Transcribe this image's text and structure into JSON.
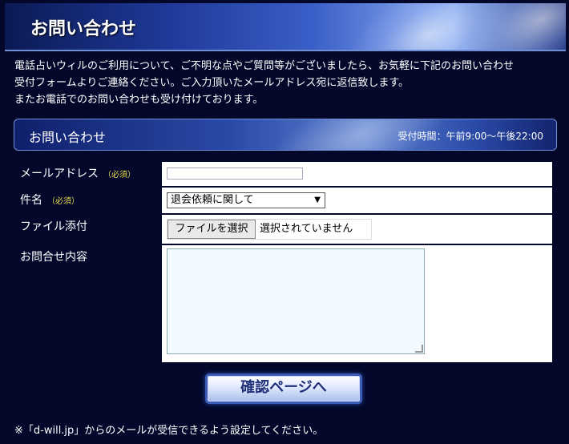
{
  "header": {
    "title": "お問い合わせ"
  },
  "intro": {
    "line1": "電話占いウィルのご利用について、ご不明な点やご質問等がございましたら、お気軽に下記のお問い合わせ",
    "line2": "受付フォームよりご連絡ください。ご入力頂いたメールアドレス宛に返信致します。",
    "line3": "またお電話でのお問い合わせも受け付けております。"
  },
  "section": {
    "title": "お問い合わせ",
    "hours": "受付時間：午前9:00〜午後22:00"
  },
  "form": {
    "email": {
      "label": "メールアドレス",
      "required": "（必須）",
      "value": ""
    },
    "subject": {
      "label": "件名",
      "required": "（必須）",
      "selected": "退会依頼に関して"
    },
    "file": {
      "label": "ファイル添付",
      "button": "ファイルを選択",
      "status": "選択されていません"
    },
    "message": {
      "label": "お問合せ内容",
      "value": ""
    }
  },
  "confirm_button": {
    "label": "確認ページへ"
  },
  "footnote": "※「d-will.jp」からのメールが受信できるよう設定してください。",
  "colors": {
    "background": "#03082a",
    "required": "#e8d84a",
    "button_text": "#1f2f78"
  }
}
